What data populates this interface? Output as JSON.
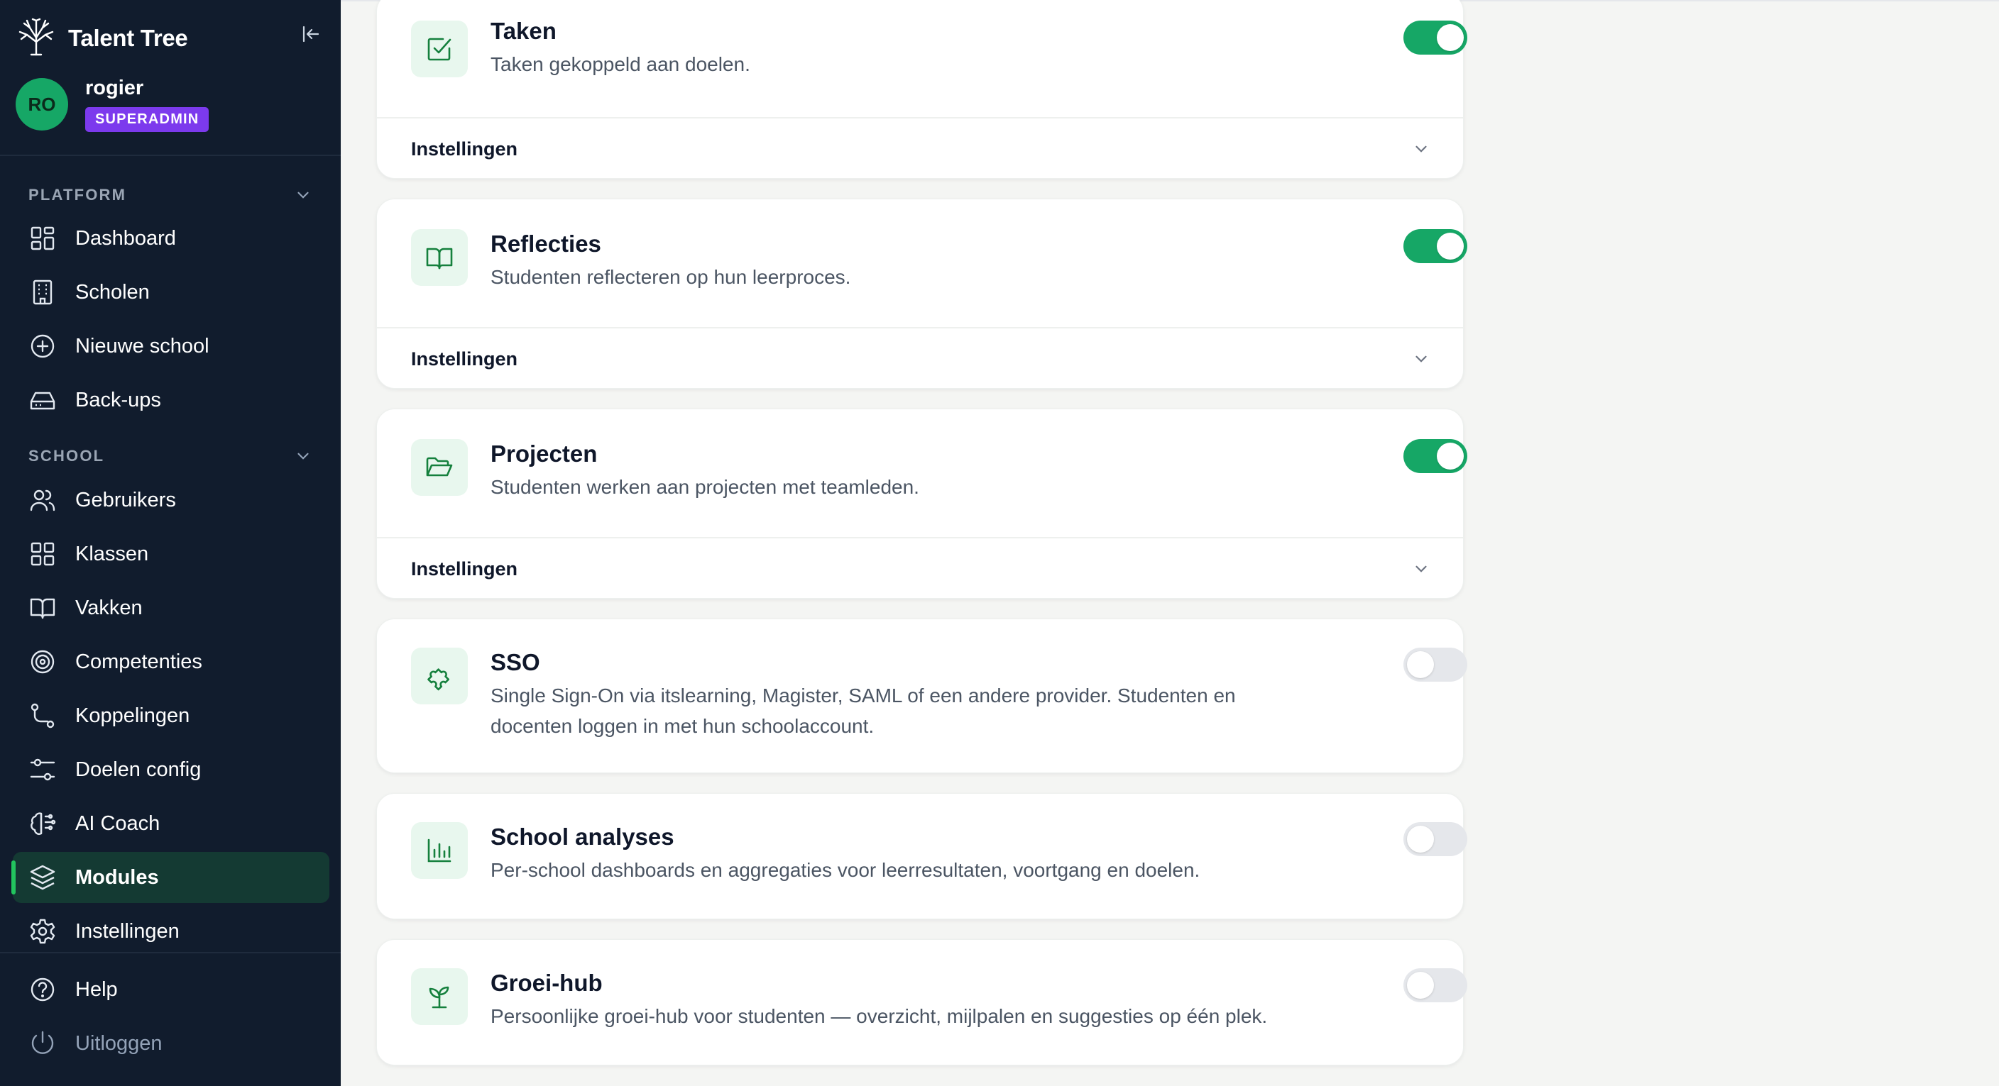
{
  "app": {
    "name": "Talent Tree"
  },
  "user": {
    "initials": "RO",
    "name": "rogier",
    "role": "SUPERADMIN"
  },
  "sidebar": {
    "platform_label": "PLATFORM",
    "platform_items": [
      {
        "label": "Dashboard",
        "icon": "dashboard-icon"
      },
      {
        "label": "Scholen",
        "icon": "building-icon"
      },
      {
        "label": "Nieuwe school",
        "icon": "plus-circle-icon"
      },
      {
        "label": "Back-ups",
        "icon": "hard-drive-icon"
      }
    ],
    "school_label": "SCHOOL",
    "school_items": [
      {
        "label": "Gebruikers",
        "icon": "users-icon"
      },
      {
        "label": "Klassen",
        "icon": "grid-icon"
      },
      {
        "label": "Vakken",
        "icon": "book-icon"
      },
      {
        "label": "Competenties",
        "icon": "target-icon"
      },
      {
        "label": "Koppelingen",
        "icon": "route-icon"
      },
      {
        "label": "Doelen config",
        "icon": "sliders-icon"
      },
      {
        "label": "AI Coach",
        "icon": "brain-icon"
      },
      {
        "label": "Modules",
        "icon": "layers-icon",
        "active": true
      },
      {
        "label": "Instellingen",
        "icon": "gear-icon"
      }
    ],
    "footer_items": [
      {
        "label": "Help",
        "icon": "help-circle-icon"
      },
      {
        "label": "Uitloggen",
        "icon": "power-icon"
      }
    ]
  },
  "modules": [
    {
      "title": "Taken",
      "description": "Taken gekoppeld aan doelen.",
      "icon": "check-square-icon",
      "enabled": true,
      "settings_label": "Instellingen"
    },
    {
      "title": "Reflecties",
      "description": "Studenten reflecteren op hun leerproces.",
      "icon": "book-open-icon",
      "enabled": true,
      "settings_label": "Instellingen"
    },
    {
      "title": "Projecten",
      "description": "Studenten werken aan projecten met teamleden.",
      "icon": "folder-open-icon",
      "enabled": true,
      "settings_label": "Instellingen"
    },
    {
      "title": "SSO",
      "description": "Single Sign-On via itslearning, Magister, SAML of een andere provider. Studenten en docenten loggen in met hun schoolaccount.",
      "icon": "puzzle-icon",
      "enabled": false
    },
    {
      "title": "School analyses",
      "description": "Per-school dashboards en aggregaties voor leerresultaten, voortgang en doelen.",
      "icon": "bar-chart-icon",
      "enabled": false
    },
    {
      "title": "Groei-hub",
      "description": "Persoonlijke groei-hub voor studenten — overzicht, mijlpalen en suggesties op één plek.",
      "icon": "sprout-icon",
      "enabled": false
    }
  ],
  "colors": {
    "sidebar_bg": "#111c2d",
    "accent": "#16a766",
    "badge": "#7c3aed",
    "active_bg": "#143a33"
  }
}
